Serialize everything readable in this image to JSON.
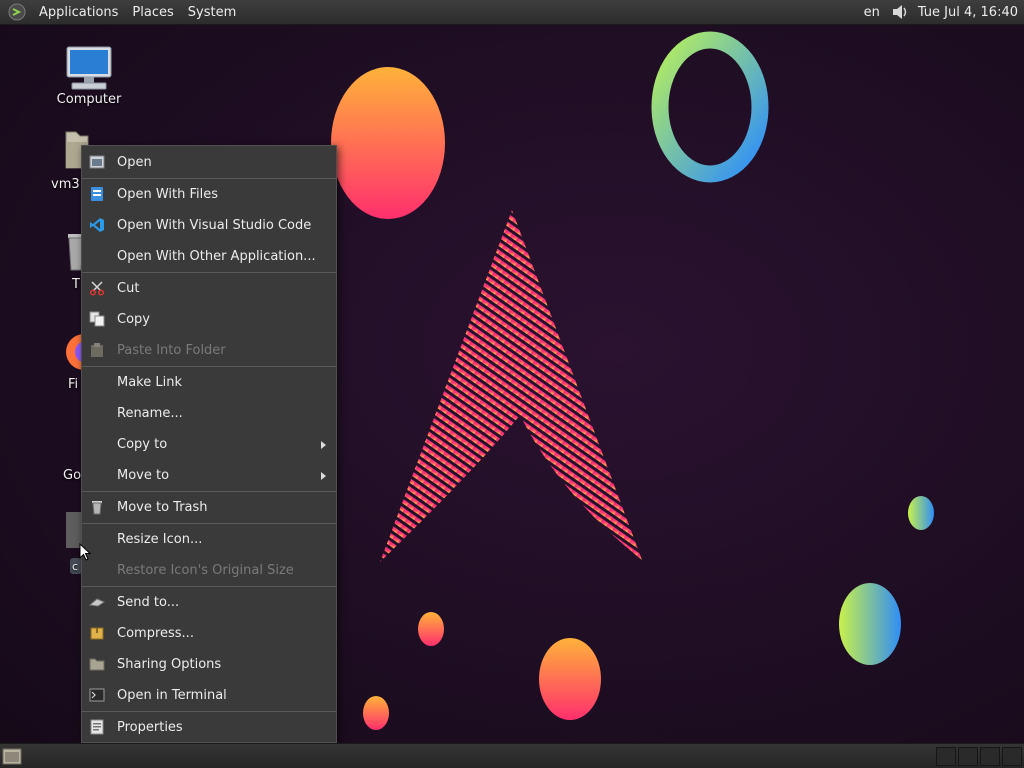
{
  "top_panel": {
    "menus": [
      "Applications",
      "Places",
      "System"
    ],
    "language": "en",
    "clock": "Tue Jul  4, 16:40"
  },
  "desktop": {
    "icons": [
      {
        "label": "Computer",
        "icon": "computer-icon"
      },
      {
        "label": "vm3",
        "icon": "home-folder-icon"
      },
      {
        "label": "T",
        "icon": "trash-icon"
      },
      {
        "label": "Fi",
        "icon": "firefox-icon"
      },
      {
        "label": "Go",
        "icon": "chrome-icon"
      },
      {
        "label": "c",
        "icon": "folder-icon"
      }
    ]
  },
  "context_menu": {
    "items": [
      {
        "label": "Open",
        "icon": "open-icon",
        "enabled": true
      },
      {
        "label": "Open With Files",
        "icon": "files-app-icon",
        "enabled": true
      },
      {
        "label": "Open With Visual Studio Code",
        "icon": "vscode-icon",
        "enabled": true
      },
      {
        "label": "Open With Other Application...",
        "icon": "",
        "enabled": true
      },
      {
        "label": "Cut",
        "icon": "scissors-icon",
        "enabled": true
      },
      {
        "label": "Copy",
        "icon": "copy-icon",
        "enabled": true
      },
      {
        "label": "Paste Into Folder",
        "icon": "paste-icon",
        "enabled": false
      },
      {
        "label": "Make Link",
        "icon": "",
        "enabled": true
      },
      {
        "label": "Rename...",
        "icon": "",
        "enabled": true
      },
      {
        "label": "Copy to",
        "icon": "",
        "enabled": true,
        "submenu": true
      },
      {
        "label": "Move to",
        "icon": "",
        "enabled": true,
        "submenu": true
      },
      {
        "label": "Move to Trash",
        "icon": "trash-icon",
        "enabled": true
      },
      {
        "label": "Resize Icon...",
        "icon": "",
        "enabled": true
      },
      {
        "label": "Restore Icon's Original Size",
        "icon": "",
        "enabled": false
      },
      {
        "label": "Send to...",
        "icon": "send-icon",
        "enabled": true
      },
      {
        "label": "Compress...",
        "icon": "archive-icon",
        "enabled": true
      },
      {
        "label": "Sharing Options",
        "icon": "share-folder-icon",
        "enabled": true
      },
      {
        "label": "Open in Terminal",
        "icon": "terminal-icon",
        "enabled": true
      },
      {
        "label": "Properties",
        "icon": "properties-icon",
        "enabled": true
      }
    ]
  },
  "colors": {
    "panel": "#2c2c2c",
    "menu_bg": "#3a3a3a",
    "wallpaper_bg": "#1d0f22",
    "accent_pink": "#ff2d7a",
    "accent_orange": "#ff9a3c"
  }
}
